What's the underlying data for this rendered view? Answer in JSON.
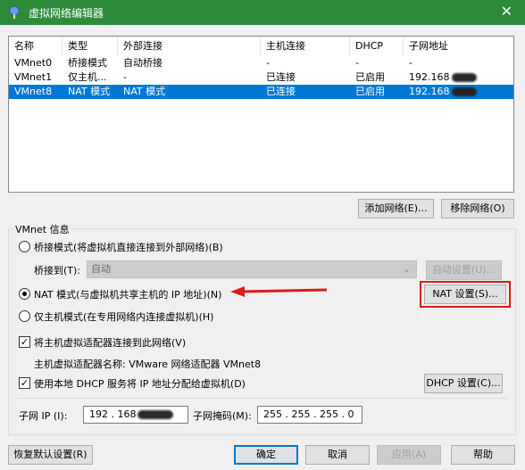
{
  "window": {
    "title": "虚拟网络编辑器",
    "close_glyph": "✕"
  },
  "net_list": {
    "headers": {
      "name": "名称",
      "type": "类型",
      "external": "外部连接",
      "host": "主机连接",
      "dhcp": "DHCP",
      "subnet": "子网地址"
    },
    "rows": [
      {
        "name": "VMnet0",
        "type": "桥接模式",
        "external": "自动桥接",
        "host": "-",
        "dhcp": "-",
        "subnet": "-"
      },
      {
        "name": "VMnet1",
        "type": "仅主机...",
        "external": "-",
        "host": "已连接",
        "dhcp": "已启用",
        "subnet": "192.168"
      },
      {
        "name": "VMnet8",
        "type": "NAT 模式",
        "external": "NAT 模式",
        "host": "已连接",
        "dhcp": "已启用",
        "subnet": "192.168"
      }
    ],
    "selected_index": 2
  },
  "buttons": {
    "add_network": "添加网络(E)...",
    "remove_network": "移除网络(O)",
    "auto_settings": "自动设置(U)...",
    "nat_settings": "NAT 设置(S)...",
    "dhcp_settings": "DHCP 设置(C)...",
    "restore_defaults": "恢复默认设置(R)",
    "ok": "确定",
    "cancel": "取消",
    "apply": "应用(A)",
    "help": "帮助"
  },
  "vmnet_info": {
    "group_label": "VMnet 信息",
    "bridged_label": "桥接模式(将虚拟机直接连接到外部网络)(B)",
    "bridged_to_label": "桥接到(T):",
    "bridged_to_value": "自动",
    "nat_label": "NAT 模式(与虚拟机共享主机的 IP 地址)(N)",
    "hostonly_label": "仅主机模式(在专用网络内连接虚拟机)(H)",
    "selected_mode": "nat",
    "connect_adapter_label": "将主机虚拟适配器连接到此网络(V)",
    "connect_adapter_checked": true,
    "adapter_name_label": "主机虚拟适配器名称: VMware 网络适配器 VMnet8",
    "use_dhcp_label": "使用本地 DHCP 服务将 IP 地址分配给虚拟机(D)",
    "use_dhcp_checked": true,
    "subnet_ip_label": "子网 IP (I):",
    "subnet_ip_value": "192 . 168",
    "subnet_mask_label": "子网掩码(M):",
    "subnet_mask_value": "255 . 255 . 255 . 0"
  },
  "colors": {
    "titlebar": "#2e8b3a",
    "selection": "#0078d7",
    "annotation": "#e11919"
  }
}
